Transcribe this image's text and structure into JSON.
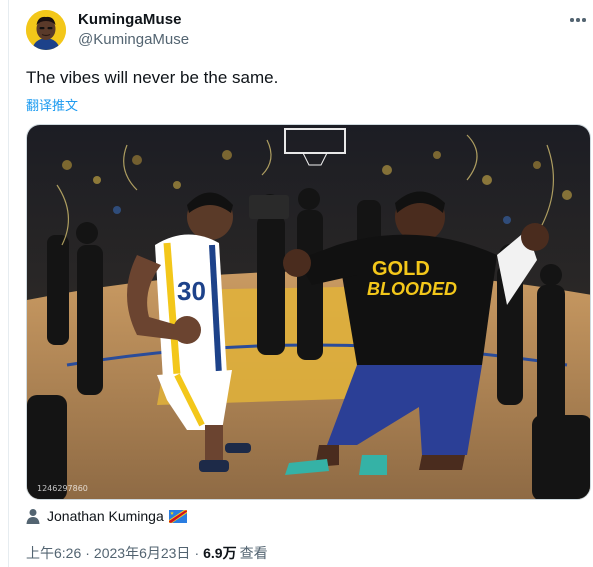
{
  "author": {
    "display_name": "KumingaMuse",
    "handle": "@KumingaMuse",
    "avatar_icon": "cartoon-avatar-icon"
  },
  "more_icon": "more-horizontal-icon",
  "tweet": {
    "text": "The vibes will never be the same.",
    "translate_label": "翻译推文"
  },
  "media": {
    "watermark": "1246297860",
    "shirt_line1": "GOLD",
    "shirt_line2": "BLOODED",
    "jersey_number": "30"
  },
  "tagged": {
    "person_icon": "person-icon",
    "name": "Jonathan Kuminga",
    "flag_icon": "dr-congo-flag-icon"
  },
  "meta": {
    "time": "上午6:26",
    "separator": "·",
    "date": "2023年6月23日",
    "views_count": "6.9万",
    "views_label": "查看"
  },
  "colors": {
    "link": "#1d9bf0",
    "secondary_text": "#536471",
    "primary_text": "#0f1419",
    "warriors_gold": "#f3c71a",
    "warriors_blue": "#1d428a"
  }
}
